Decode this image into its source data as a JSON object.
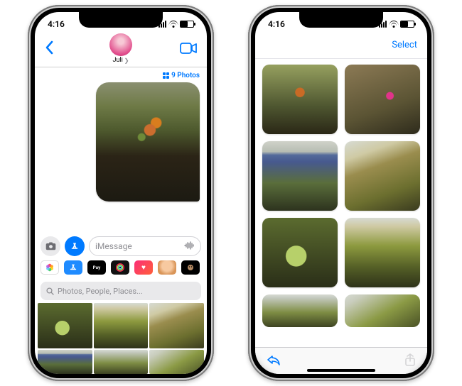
{
  "status": {
    "time": "4:16",
    "am_indicator": "⁠"
  },
  "left": {
    "contact_name": "Juli",
    "photo_count_label": "9 Photos",
    "compose_placeholder": "iMessage",
    "search_placeholder": "Photos, People, Places...",
    "app_icons": [
      {
        "name": "photos-app",
        "bg": "#fff",
        "glyph": "❀",
        "color": "linear"
      },
      {
        "name": "appstore-app",
        "bg": "#1f8bff",
        "glyph": "A"
      },
      {
        "name": "applepay-app",
        "bg": "#000",
        "glyph": "Pay",
        "fs": "7px"
      },
      {
        "name": "activity-app",
        "bg": "#1a1a1a",
        "glyph": "◎",
        "color": "#48e06d"
      },
      {
        "name": "music-app",
        "bg": "linear-gradient(135deg,#fb2d78,#ff5f3a)",
        "glyph": "♥"
      },
      {
        "name": "memoji-app",
        "bg": "#f3c28b",
        "glyph": "☻",
        "color": "#7a4a20"
      },
      {
        "name": "animoji-app",
        "bg": "#000",
        "glyph": "☻",
        "color": "#b77"
      }
    ]
  },
  "right": {
    "select_label": "Select"
  }
}
